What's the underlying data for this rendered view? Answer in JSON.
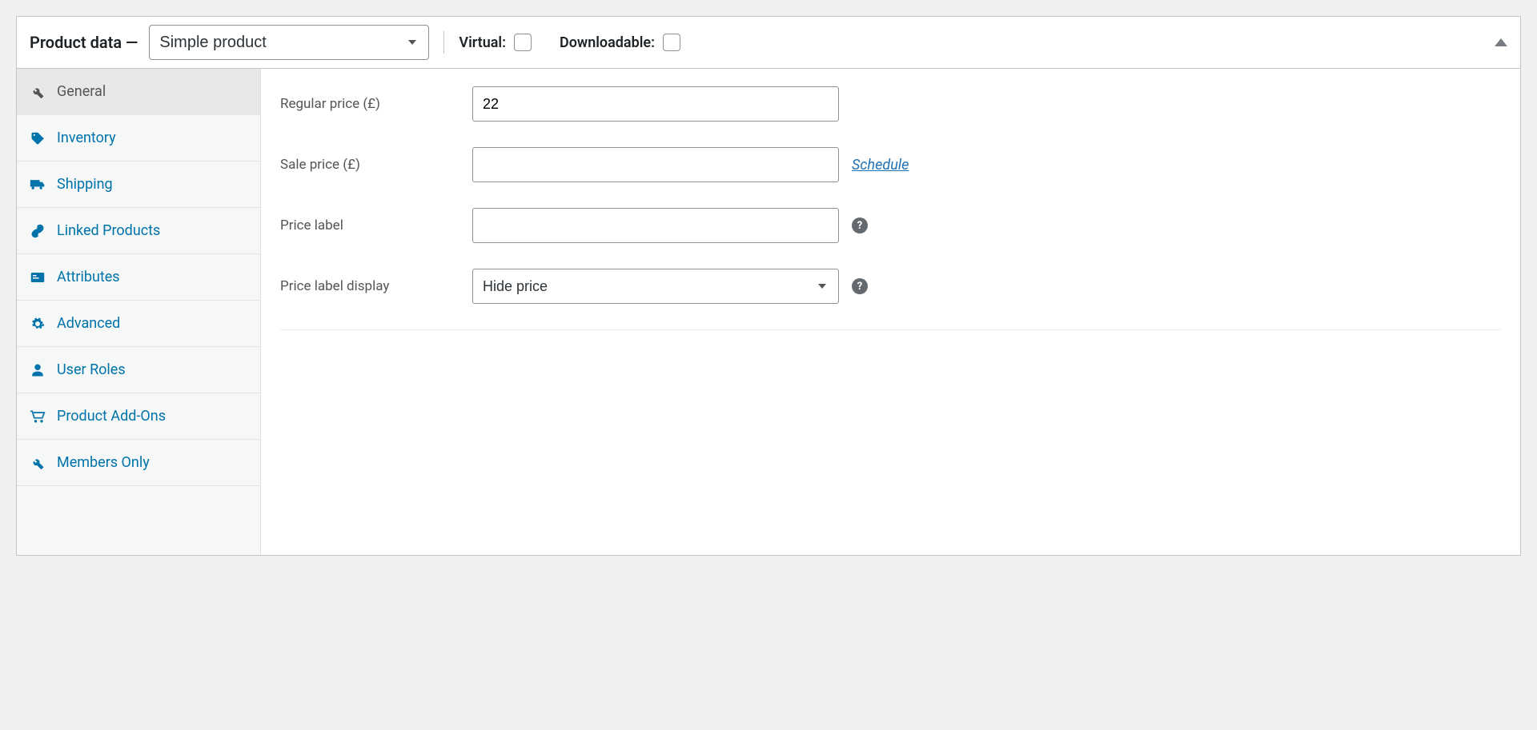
{
  "header": {
    "title": "Product data —",
    "product_type": "Simple product",
    "virtual_label": "Virtual:",
    "downloadable_label": "Downloadable:"
  },
  "tabs": {
    "general": "General",
    "inventory": "Inventory",
    "shipping": "Shipping",
    "linked": "Linked Products",
    "attributes": "Attributes",
    "advanced": "Advanced",
    "user_roles": "User Roles",
    "addons": "Product Add-Ons",
    "members": "Members Only"
  },
  "fields": {
    "regular_price": {
      "label": "Regular price (£)",
      "value": "22"
    },
    "sale_price": {
      "label": "Sale price (£)",
      "value": "",
      "schedule": "Schedule"
    },
    "price_label": {
      "label": "Price label",
      "value": ""
    },
    "price_label_display": {
      "label": "Price label display",
      "value": "Hide price"
    }
  }
}
